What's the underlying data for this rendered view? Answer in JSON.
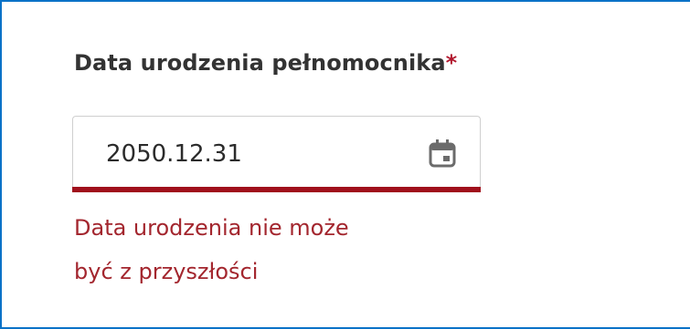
{
  "form": {
    "label": "Data urodzenia pełnomocnika",
    "required_mark": "*",
    "value": "2050.12.31",
    "error_lines": [
      "Data urodzenia nie może",
      "być z przyszłości"
    ]
  },
  "icons": {
    "calendar": "calendar-icon"
  },
  "colors": {
    "label": "#333333",
    "required": "#b2172e",
    "error": "#a3262e",
    "error_underline": "#a00f1c",
    "frame_border": "#0a72c7"
  }
}
